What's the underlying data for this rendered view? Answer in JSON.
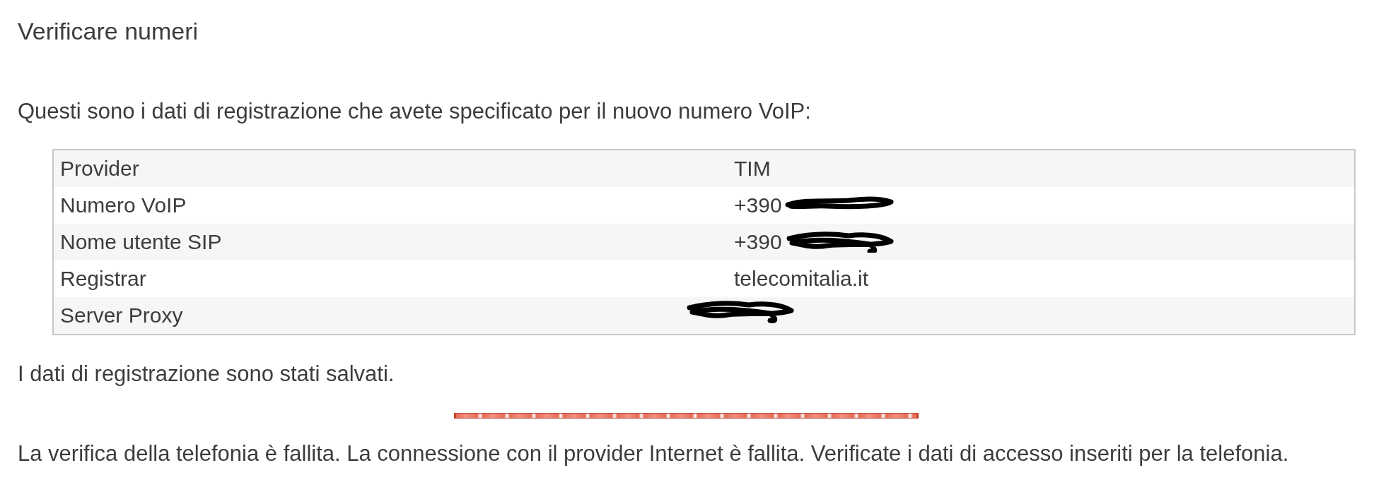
{
  "title": "Verificare numeri",
  "intro": "Questi sono i dati di registrazione che avete specificato per il nuovo numero VoIP:",
  "table": {
    "rows": [
      {
        "label": "Provider",
        "value": "TIM",
        "redacted": false
      },
      {
        "label": "Numero VoIP",
        "value": "+390",
        "redacted": true
      },
      {
        "label": "Nome utente SIP",
        "value": "+390",
        "redacted": true
      },
      {
        "label": "Registrar",
        "value": "telecomitalia.it",
        "redacted": false
      },
      {
        "label": "Server Proxy",
        "redacted": true
      }
    ]
  },
  "saved_message": "I dati di registrazione sono stati salvati.",
  "progress": {
    "level": 1
  },
  "error_message": "La verifica della telefonia è fallita. La connessione con il provider Internet è fallita. Verificate i dati di accesso inseriti per la telefonia."
}
